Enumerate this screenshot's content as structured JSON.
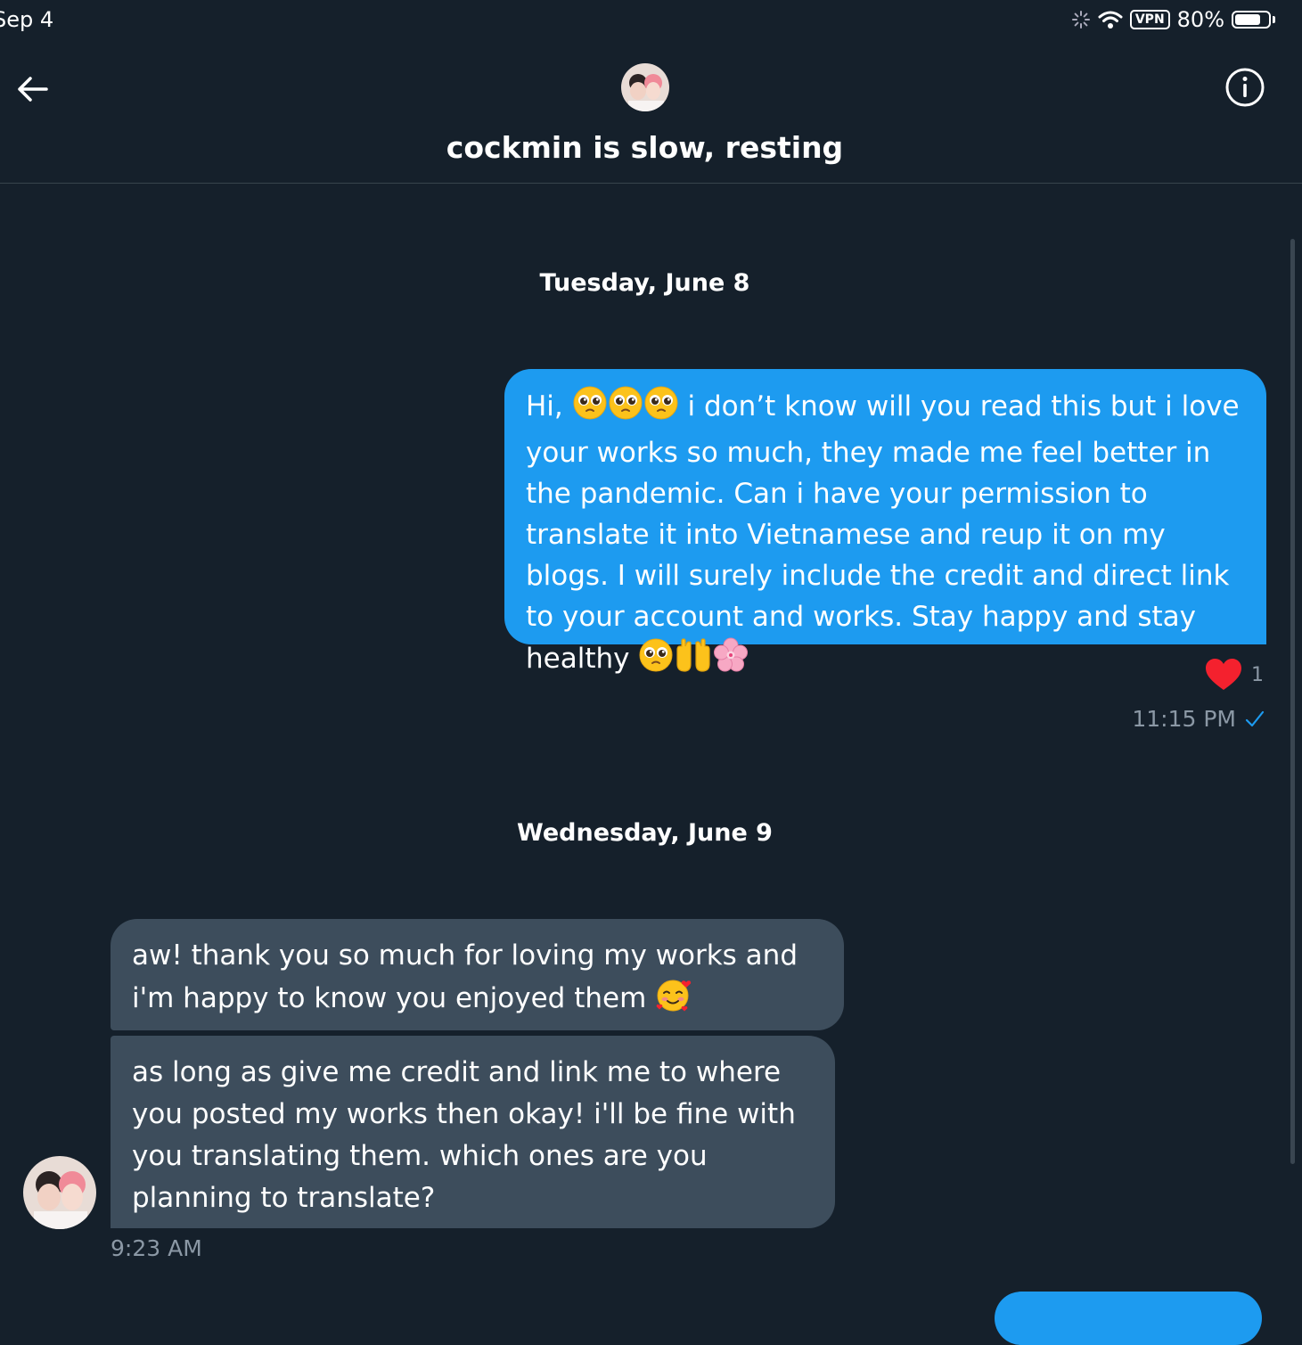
{
  "status_bar": {
    "time": "Sep 4",
    "vpn": "VPN",
    "battery": "80%",
    "battery_level": 0.8
  },
  "header": {
    "title": "cockmin is slow, resting"
  },
  "conversation": {
    "days": [
      {
        "label": "Tuesday, June 8",
        "messages": [
          {
            "direction": "outgoing",
            "text_start": "Hi, ",
            "text_middle": " i don’t know will you read this but i love your works so much, they made me feel better in the pandemic. Can i have your permission to translate it into Vietnamese and reup it on my blogs. I will surely include the credit and direct link to your account and works. Stay happy and stay healthy ",
            "reaction_count": "1",
            "time": "11:15 PM"
          }
        ]
      },
      {
        "label": "Wednesday, June 9",
        "messages": [
          {
            "direction": "incoming",
            "text": "aw! thank you so much for loving my works and i'm happy to know you enjoyed them "
          },
          {
            "direction": "incoming",
            "text": "as long as give me credit and link me to where you posted my works then okay! i'll be fine with you translating them. which ones are you planning to translate?",
            "time": "9:23 AM"
          }
        ]
      }
    ]
  },
  "icons": {
    "back": "arrow-left-icon",
    "info": "info-circle-icon",
    "wifi": "wifi-icon",
    "heart": "heart-icon",
    "check": "check-icon",
    "pleading": "pleading-face-emoji",
    "hands": "raised-hands-emoji",
    "flower": "cherry-blossom-emoji",
    "smiling_hearts": "smiling-face-with-hearts-emoji"
  },
  "colors": {
    "background": "#15202b",
    "accent": "#1d9bf0",
    "incoming_bubble": "#3d4d5c",
    "muted": "#8b98a5",
    "heart": "#f4212e"
  }
}
